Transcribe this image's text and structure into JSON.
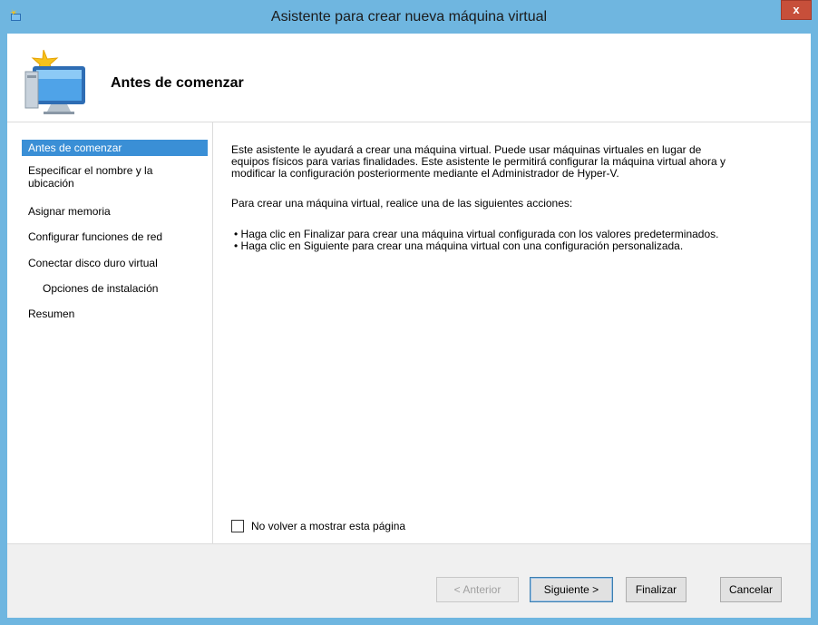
{
  "window": {
    "title": "Asistente para crear nueva máquina virtual",
    "close_label": "x"
  },
  "header": {
    "title": "Antes de comenzar"
  },
  "steps": [
    {
      "label": "Antes de comenzar",
      "active": true
    },
    {
      "label": "Especificar el nombre y la ubicación",
      "active": false
    },
    {
      "label": "Asignar memoria",
      "active": false
    },
    {
      "label": "Configurar funciones de red",
      "active": false
    },
    {
      "label": "Conectar disco duro virtual",
      "active": false
    },
    {
      "label": "Opciones de instalación",
      "active": false
    },
    {
      "label": "Resumen",
      "active": false
    }
  ],
  "content": {
    "intro_line1": "Este asistente le ayudará a crear una máquina virtual. Puede usar máquinas virtuales en lugar de",
    "intro_line2": "equipos físicos para varias finalidades. Este asistente le permitirá configurar la máquina virtual ahora y",
    "intro_line3": "modificar la configuración posteriormente mediante el Administrador de Hyper-V.",
    "instruction": "Para crear una máquina virtual, realice una de las siguientes acciones:",
    "bullets": [
      "• Haga clic en Finalizar para crear una máquina virtual configurada con los valores predeterminados.",
      "• Haga clic en Siguiente para crear una máquina virtual con una configuración personalizada."
    ],
    "checkbox_label": "No volver a mostrar esta página",
    "checkbox_checked": false
  },
  "buttons": {
    "previous": "< Anterior",
    "next": "Siguiente >",
    "finish": "Finalizar",
    "cancel": "Cancelar"
  },
  "colors": {
    "titlebar": "#6fb6e0",
    "selection": "#3a8fd6",
    "close": "#c74f3a"
  }
}
